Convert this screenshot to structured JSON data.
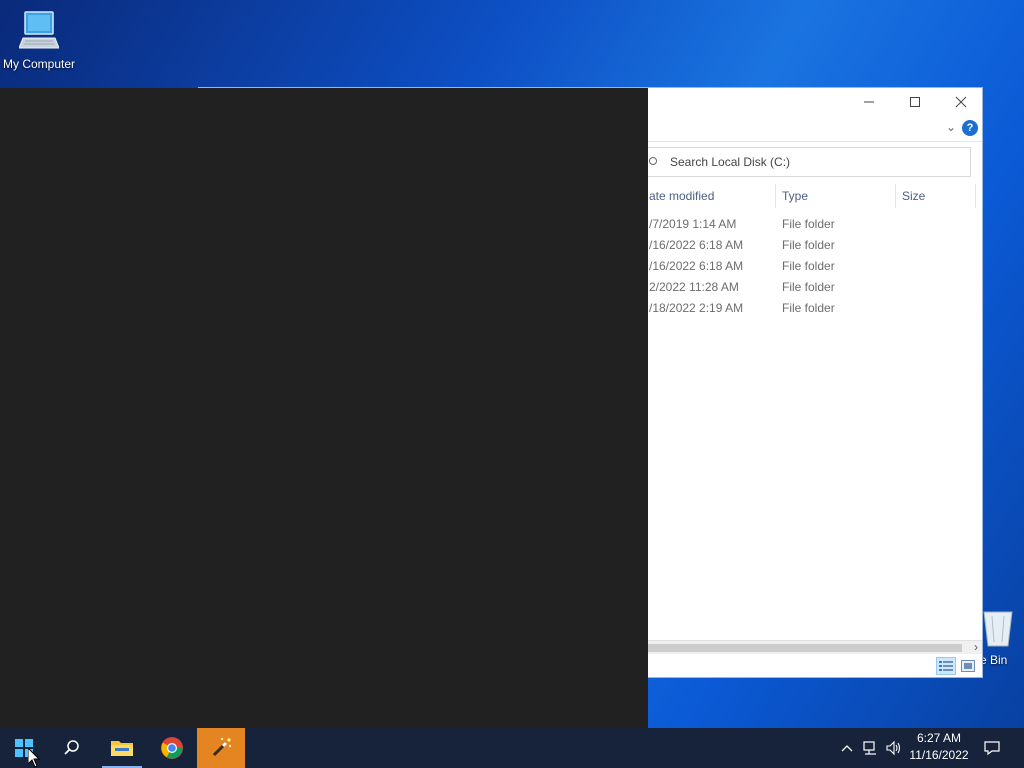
{
  "desktop": {
    "icons": [
      {
        "label": "My Computer",
        "icon": "computer-icon"
      },
      {
        "label": "Recycle Bin",
        "visible_label": "e Bin",
        "icon": "recycle-bin-icon"
      }
    ]
  },
  "explorer": {
    "window_buttons": [
      "minimize",
      "maximize",
      "close"
    ],
    "search_placeholder": "Search Local Disk (C:)",
    "columns": [
      "ate modified",
      "Type",
      "Size"
    ],
    "rows": [
      {
        "date": "/7/2019 1:14 AM",
        "type": "File folder"
      },
      {
        "date": "/16/2022 6:18 AM",
        "type": "File folder"
      },
      {
        "date": "/16/2022 6:18 AM",
        "type": "File folder"
      },
      {
        "date": "2/2022 11:28 AM",
        "type": "File folder"
      },
      {
        "date": "/18/2022 2:19 AM",
        "type": "File folder"
      }
    ],
    "help_label": "?"
  },
  "taskbar": {
    "pinned": [
      {
        "name": "start",
        "icon": "windows-logo-icon"
      },
      {
        "name": "search",
        "icon": "search-icon"
      },
      {
        "name": "file-explorer",
        "icon": "folder-icon"
      },
      {
        "name": "chrome",
        "icon": "chrome-icon"
      },
      {
        "name": "magic-wand-app",
        "icon": "magic-wand-icon"
      }
    ],
    "clock": {
      "time": "6:27 AM",
      "date": "11/16/2022"
    },
    "colors": {
      "taskbar": "#16233a",
      "active_app": "#e48521",
      "dark_panel": "#212121"
    }
  }
}
